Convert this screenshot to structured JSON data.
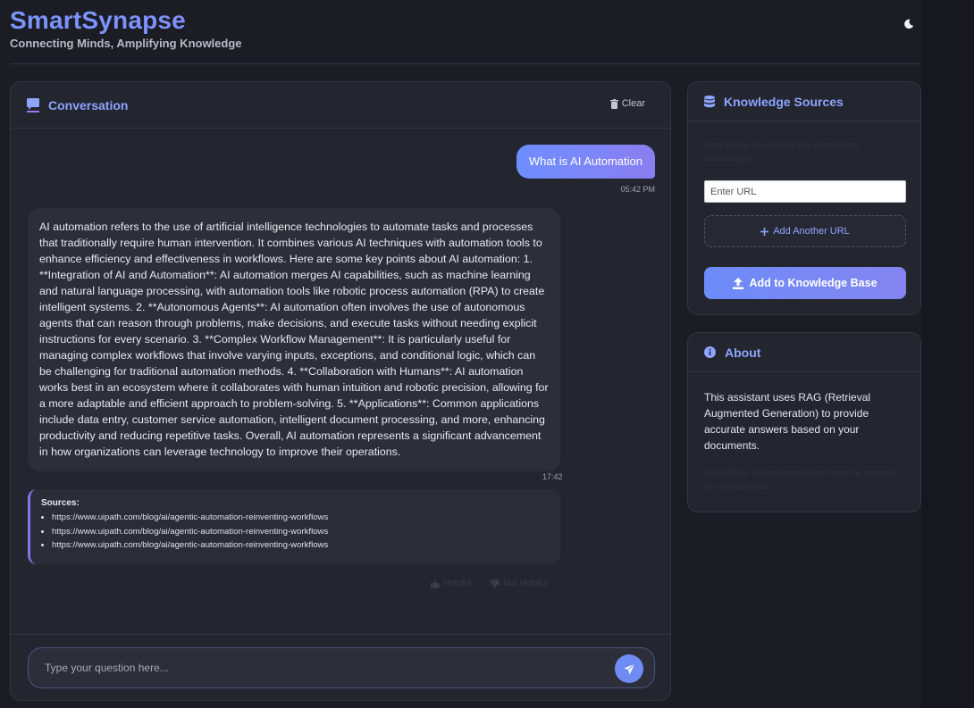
{
  "header": {
    "brand": "SmartSynapse",
    "tagline": "Connecting Minds, Amplifying Knowledge",
    "theme_icon": "moon-icon"
  },
  "conversation": {
    "title": "Conversation",
    "clear_label": "Clear",
    "user_message": {
      "text": "What is AI Automation",
      "time": "05:42 PM"
    },
    "bot_message": {
      "text": "AI automation refers to the use of artificial intelligence technologies to automate tasks and processes that traditionally require human intervention. It combines various AI techniques with automation tools to enhance efficiency and effectiveness in workflows. Here are some key points about AI automation: 1. **Integration of AI and Automation**: AI automation merges AI capabilities, such as machine learning and natural language processing, with automation tools like robotic process automation (RPA) to create intelligent systems. 2. **Autonomous Agents**: AI automation often involves the use of autonomous agents that can reason through problems, make decisions, and execute tasks without needing explicit instructions for every scenario. 3. **Complex Workflow Management**: It is particularly useful for managing complex workflows that involve varying inputs, exceptions, and conditional logic, which can be challenging for traditional automation methods. 4. **Collaboration with Humans**: AI automation works best in an ecosystem where it collaborates with human intuition and robotic precision, allowing for a more adaptable and efficient approach to problem-solving. 5. **Applications**: Common applications include data entry, customer service automation, intelligent document processing, and more, enhancing productivity and reducing repetitive tasks. Overall, AI automation represents a significant advancement in how organizations can leverage technology to improve their operations.",
      "time": "17:42"
    },
    "sources": {
      "title": "Sources:",
      "items": [
        "https://www.uipath.com/blog/ai/agentic-automation-reinventing-workflows",
        "https://www.uipath.com/blog/ai/agentic-automation-reinventing-workflows",
        "https://www.uipath.com/blog/ai/agentic-automation-reinventing-workflows"
      ]
    },
    "feedback": {
      "helpful": "Helpful",
      "not_helpful": "Not Helpful"
    },
    "input_placeholder": "Type your question here..."
  },
  "knowledge_sources": {
    "title": "Knowledge Sources",
    "description": "Add URLs to expand the assistant's knowledge:",
    "url_placeholder": "Enter URL",
    "add_another_label": "Add Another URL",
    "add_kb_label": "Add to Knowledge Base"
  },
  "about": {
    "title": "About",
    "text": "This assistant uses RAG (Retrieval Augmented Generation) to provide accurate answers based on your documents.",
    "faint_text": "Add URLs to the knowledge base to expand its capabilities."
  },
  "colors": {
    "accent": "#7a96ff",
    "accent2": "#9a79e8",
    "background": "#1b1c24",
    "panel": "#23252f"
  }
}
